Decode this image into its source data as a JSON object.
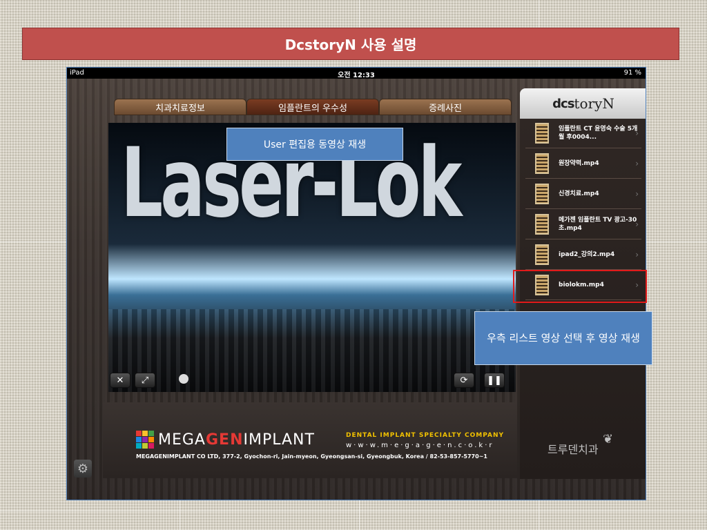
{
  "slide": {
    "title": "DcstoryN 사용 설명"
  },
  "status_bar": {
    "device": "iPad",
    "time": "오전 12:33",
    "battery": "91 %"
  },
  "tabs": [
    {
      "label": "치과치료정보"
    },
    {
      "label": "임플란트의 우수성"
    },
    {
      "label": "증례사진"
    }
  ],
  "app_logo": {
    "prefix": "dcs",
    "suffix": "toryN"
  },
  "video": {
    "overlay_text": "Laser-Lok"
  },
  "annotations": {
    "video_note": "User 편집용 동영상 재생",
    "list_note": "우측 리스트 영상 선택 후 영상 재생"
  },
  "controls": {
    "close": "✕",
    "fullscreen": "⤢",
    "repeat": "⟳",
    "pause": "❚❚"
  },
  "playlist": [
    {
      "title": "임플란트 CT 윤영숙 수술 5개월 후0004..."
    },
    {
      "title": "원장약력.mp4"
    },
    {
      "title": "신경치료.mp4"
    },
    {
      "title": "메가젠 임플란트 TV 광고-30초.mp4"
    },
    {
      "title": "ipad2_강의2.mp4"
    },
    {
      "title": "biolokm.mp4"
    }
  ],
  "banner": {
    "company": "MEGAGENIMPLANT",
    "mega": "MEGA",
    "gen": "GEN",
    "implant": "IMPLANT",
    "tagline": "DENTAL IMPLANT SPECIALTY COMPANY",
    "url": "w·w·w.m·e·g·a·g·e·n.c·o.k·r",
    "address": "MEGAGENIMPLANT CO LTD, 377-2, Gyochon-ri, Jain-myeon, Gyeongsan-si, Gyeongbuk, Korea / 82-53-857-5770~1"
  },
  "clinic": {
    "name": "트루덴치과"
  },
  "colors": {
    "title_bar": "#c0504d",
    "callout": "#4f81bd",
    "highlight": "#e21a1a"
  }
}
